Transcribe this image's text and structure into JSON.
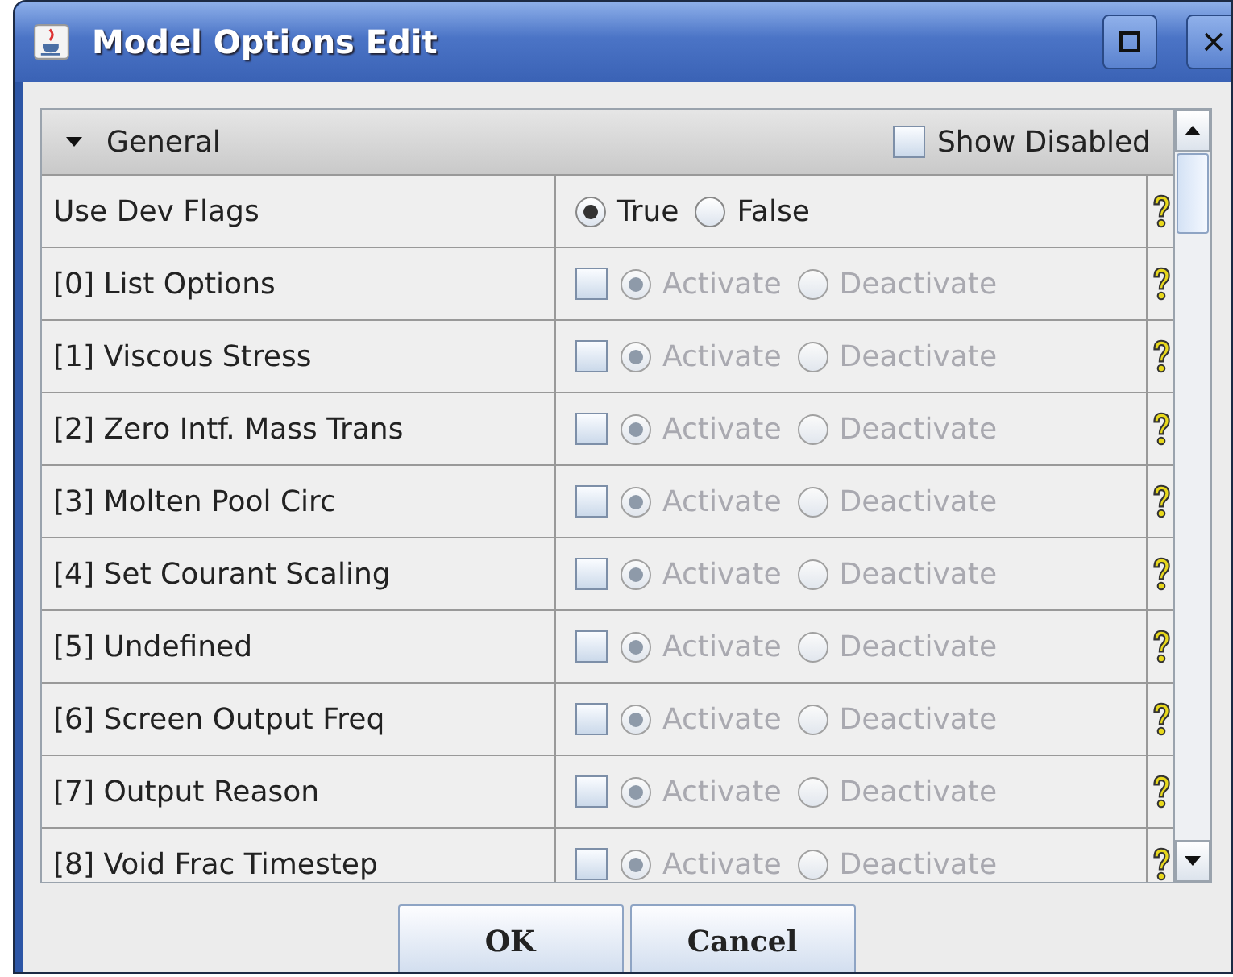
{
  "window": {
    "title": "Model Options Edit"
  },
  "section": {
    "label": "General",
    "expanded": true,
    "show_disabled": {
      "label": "Show Disabled",
      "checked": false
    }
  },
  "rows": [
    {
      "kind": "choice",
      "label": "Use Dev Flags",
      "enabled": true,
      "options": [
        {
          "label": "True",
          "selected": true
        },
        {
          "label": "False",
          "selected": false
        }
      ]
    },
    {
      "kind": "flag",
      "label": "[0] List Options",
      "checked": false,
      "enabled": false,
      "options": [
        {
          "label": "Activate",
          "selected": true
        },
        {
          "label": "Deactivate",
          "selected": false
        }
      ]
    },
    {
      "kind": "flag",
      "label": "[1] Viscous Stress",
      "checked": false,
      "enabled": false,
      "options": [
        {
          "label": "Activate",
          "selected": true
        },
        {
          "label": "Deactivate",
          "selected": false
        }
      ]
    },
    {
      "kind": "flag",
      "label": "[2] Zero Intf. Mass Trans",
      "checked": false,
      "enabled": false,
      "options": [
        {
          "label": "Activate",
          "selected": true
        },
        {
          "label": "Deactivate",
          "selected": false
        }
      ]
    },
    {
      "kind": "flag",
      "label": "[3] Molten Pool Circ",
      "checked": false,
      "enabled": false,
      "options": [
        {
          "label": "Activate",
          "selected": true
        },
        {
          "label": "Deactivate",
          "selected": false
        }
      ]
    },
    {
      "kind": "flag",
      "label": "[4] Set Courant Scaling",
      "checked": false,
      "enabled": false,
      "options": [
        {
          "label": "Activate",
          "selected": true
        },
        {
          "label": "Deactivate",
          "selected": false
        }
      ]
    },
    {
      "kind": "flag",
      "label": "[5] Undefined",
      "checked": false,
      "enabled": false,
      "options": [
        {
          "label": "Activate",
          "selected": true
        },
        {
          "label": "Deactivate",
          "selected": false
        }
      ]
    },
    {
      "kind": "flag",
      "label": "[6] Screen Output Freq",
      "checked": false,
      "enabled": false,
      "options": [
        {
          "label": "Activate",
          "selected": true
        },
        {
          "label": "Deactivate",
          "selected": false
        }
      ]
    },
    {
      "kind": "flag",
      "label": "[7] Output Reason",
      "checked": false,
      "enabled": false,
      "options": [
        {
          "label": "Activate",
          "selected": true
        },
        {
          "label": "Deactivate",
          "selected": false
        }
      ]
    },
    {
      "kind": "flag",
      "label": "[8] Void Frac Timestep",
      "checked": false,
      "enabled": false,
      "options": [
        {
          "label": "Activate",
          "selected": true
        },
        {
          "label": "Deactivate",
          "selected": false
        }
      ]
    }
  ],
  "buttons": [
    "OK",
    "Cancel"
  ]
}
